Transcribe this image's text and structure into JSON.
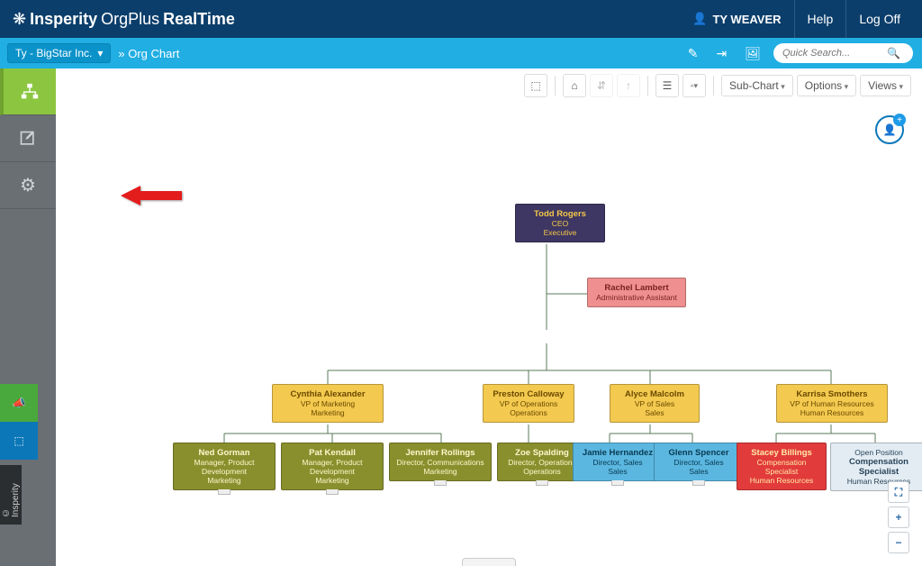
{
  "brand": {
    "company": "Insperity",
    "product": "OrgPlus",
    "suffix": "RealTime"
  },
  "topbar": {
    "user": "TY WEAVER",
    "help": "Help",
    "logoff": "Log Off"
  },
  "toolbar": {
    "org_selector": "Ty - BigStar Inc.",
    "breadcrumb": "» Org Chart",
    "search_placeholder": "Quick Search..."
  },
  "chart_toolbar": {
    "subchart": "Sub-Chart",
    "options": "Options",
    "views": "Views"
  },
  "copyright": "© Insperity",
  "chart_data": {
    "type": "tree",
    "root": {
      "name": "Todd Rogers",
      "title": "CEO",
      "dept": "Executive",
      "assistant": {
        "name": "Rachel Lambert",
        "title": "Administrative Assistant"
      },
      "children": [
        {
          "name": "Cynthia Alexander",
          "title": "VP of Marketing",
          "dept": "Marketing",
          "children": [
            {
              "name": "Ned Gorman",
              "title": "Manager, Product Development",
              "dept": "Marketing"
            },
            {
              "name": "Pat Kendall",
              "title": "Manager, Product Development",
              "dept": "Marketing"
            },
            {
              "name": "Jennifer Rollings",
              "title": "Director, Communications",
              "dept": "Marketing"
            }
          ]
        },
        {
          "name": "Preston Calloway",
          "title": "VP of Operations",
          "dept": "Operations",
          "children": [
            {
              "name": "Zoe Spalding",
              "title": "Director, Operations",
              "dept": "Operations"
            }
          ]
        },
        {
          "name": "Alyce Malcolm",
          "title": "VP of Sales",
          "dept": "Sales",
          "children": [
            {
              "name": "Jamie Hernandez",
              "title": "Director, Sales",
              "dept": "Sales"
            },
            {
              "name": "Glenn Spencer",
              "title": "Director, Sales",
              "dept": "Sales"
            }
          ]
        },
        {
          "name": "Karrisa Smothers",
          "title": "VP of Human Resources",
          "dept": "Human Resources",
          "children": [
            {
              "name": "Stacey Billings",
              "title": "Compensation Specialist",
              "dept": "Human Resources"
            },
            {
              "name": "Open Position",
              "title": "Compensation Specialist",
              "dept": "Human Resources",
              "open": true
            }
          ]
        }
      ]
    }
  }
}
